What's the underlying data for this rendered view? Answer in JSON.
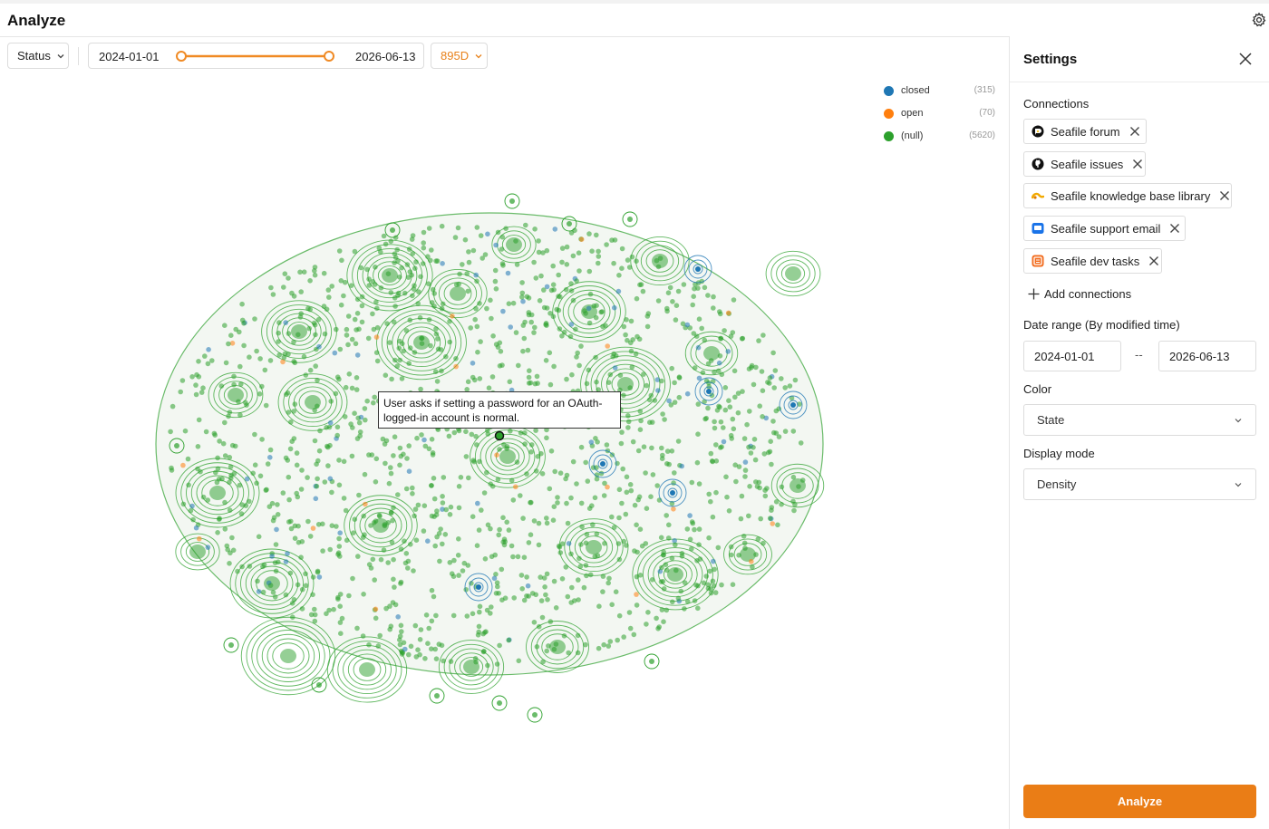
{
  "header": {
    "title": "Analyze",
    "settings_icon": "gear-icon"
  },
  "toolbar": {
    "status_label": "Status",
    "date_from": "2024-01-01",
    "date_to": "2026-06-13",
    "days_label": "895D",
    "accent_color": "#e8811a"
  },
  "legend": [
    {
      "label": "closed",
      "count": "(315)",
      "color": "#1f77b4"
    },
    {
      "label": "open",
      "count": "(70)",
      "color": "#ff7f0e"
    },
    {
      "label": "(null)",
      "count": "(5620)",
      "color": "#2ca02c"
    }
  ],
  "plot": {
    "display": "density",
    "hovered_point_text": "User asks if setting a password for an OAuth-logged-in account is normal."
  },
  "settings": {
    "title": "Settings",
    "connections_label": "Connections",
    "connections": [
      {
        "label": "Seafile forum",
        "icon": "forum-icon"
      },
      {
        "label": "Seafile issues",
        "icon": "github-icon"
      },
      {
        "label": "Seafile knowledge base library",
        "icon": "library-icon"
      },
      {
        "label": "Seafile support email",
        "icon": "email-icon"
      },
      {
        "label": "Seafile dev tasks",
        "icon": "tasks-icon"
      }
    ],
    "add_connections_label": "Add connections",
    "date_range_label": "Date range (By modified time)",
    "date_from": "2024-01-01",
    "date_separator": "--",
    "date_to": "2026-06-13",
    "color_label": "Color",
    "color_value": "State",
    "display_mode_label": "Display mode",
    "display_mode_value": "Density",
    "analyze_label": "Analyze"
  }
}
